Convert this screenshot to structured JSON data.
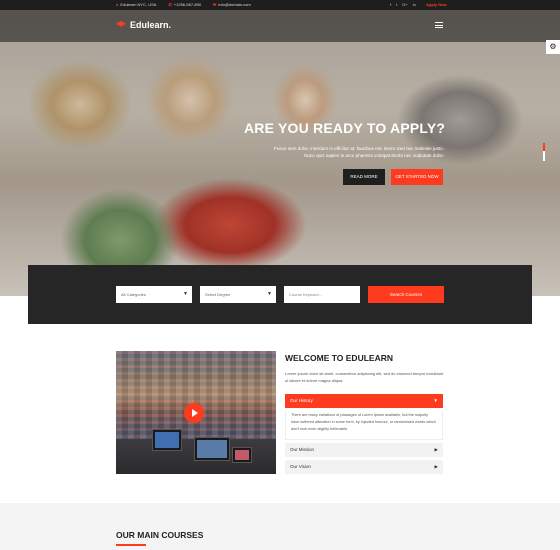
{
  "topbar": {
    "address": "Edulearn NYC, USA",
    "phone": "+1256-567-890",
    "email": "info@domain.com",
    "socials": [
      "f",
      "t",
      "G+",
      "in"
    ],
    "apply": "Apply Now"
  },
  "brand": {
    "name": "Edulearn.",
    "accent": "#ff3b1f"
  },
  "hero": {
    "title": "ARE YOU READY TO APPLY?",
    "subtitle_line1": "Fusce sem dolor, interdum in efficitur at, faucibus nec lorem.Sed nec molestie justo.",
    "subtitle_line2": "Nunc quis sapien in arcu pharetra volutpat.Morbi nec vulputate dolor.",
    "read_more": "READ MORE",
    "get_started": "GET STARTED NOW"
  },
  "search": {
    "categories": "All Categories",
    "degree": "Select Degree",
    "keyword_placeholder": "Course Keyword...",
    "button": "Search Courses"
  },
  "welcome": {
    "title": "WELCOME TO EDULEARN",
    "text": "Lorem ipsum dolor sit amet, consectetur adipiscing elit, sed do eiusmod tempor incididunt ut labore et dolore magna aliqua.",
    "accordion": [
      {
        "label": "Our History",
        "open": true,
        "body": "There are many variations of passages of Lorem Ipsum available, but the majority have suffered alteration in some form, by injected humour, or randomised words which don't look even slightly believable."
      },
      {
        "label": "Our Mission",
        "open": false
      },
      {
        "label": "Our Vision",
        "open": false
      }
    ]
  },
  "courses": {
    "title": "OUR MAIN COURSES"
  }
}
